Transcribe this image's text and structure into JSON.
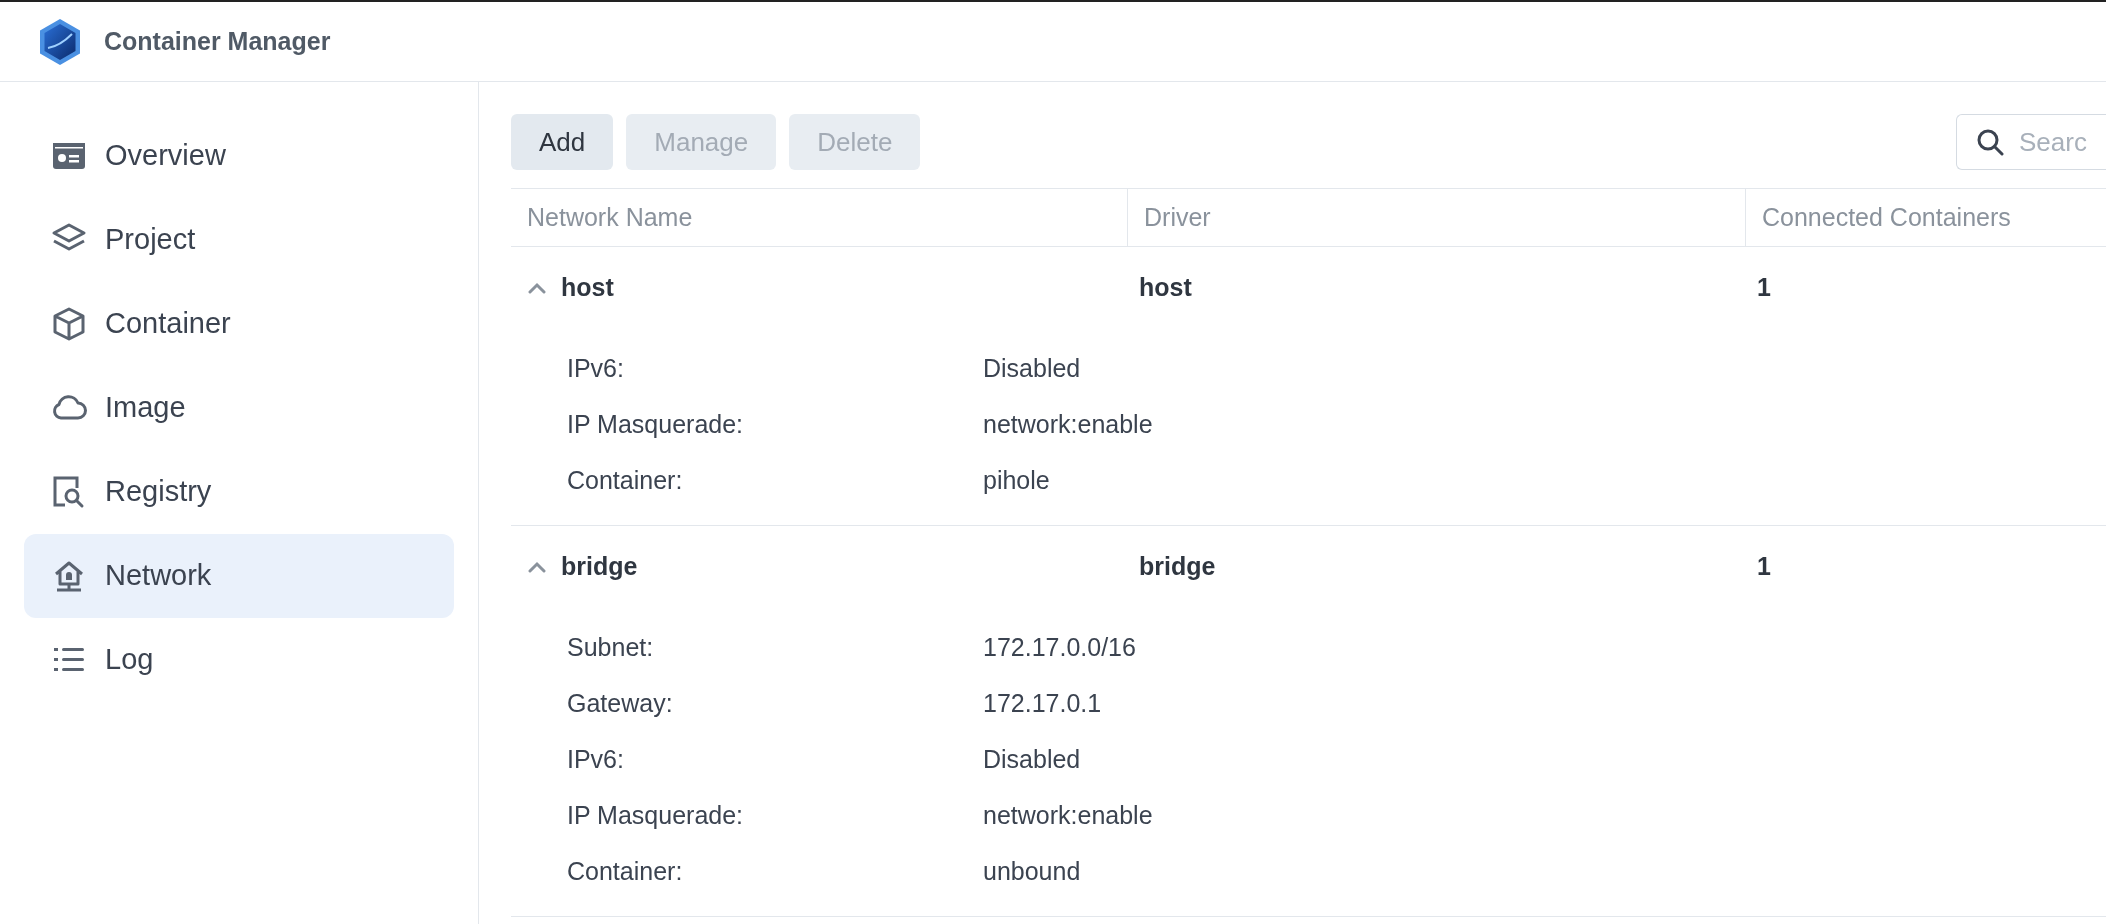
{
  "app": {
    "title": "Container Manager"
  },
  "sidebar": {
    "items": [
      {
        "label": "Overview",
        "kind": "overview",
        "selected": false
      },
      {
        "label": "Project",
        "kind": "project",
        "selected": false
      },
      {
        "label": "Container",
        "kind": "container",
        "selected": false
      },
      {
        "label": "Image",
        "kind": "image",
        "selected": false
      },
      {
        "label": "Registry",
        "kind": "registry",
        "selected": false
      },
      {
        "label": "Network",
        "kind": "network",
        "selected": true
      },
      {
        "label": "Log",
        "kind": "log",
        "selected": false
      }
    ]
  },
  "toolbar": {
    "buttons": [
      {
        "label": "Add",
        "disabled": false
      },
      {
        "label": "Manage",
        "disabled": true
      },
      {
        "label": "Delete",
        "disabled": true
      }
    ],
    "search": {
      "placeholder": "Searc"
    }
  },
  "table": {
    "columns": [
      "Network Name",
      "Driver",
      "Connected Containers"
    ],
    "rows": [
      {
        "name": "host",
        "driver": "host",
        "connected": "1",
        "expanded": true,
        "details": [
          {
            "label": "IPv6:",
            "value": "Disabled"
          },
          {
            "label": "IP Masquerade:",
            "value": "network:enable"
          },
          {
            "label": "Container:",
            "value": "pihole"
          }
        ]
      },
      {
        "name": "bridge",
        "driver": "bridge",
        "connected": "1",
        "expanded": true,
        "details": [
          {
            "label": "Subnet:",
            "value": "172.17.0.0/16"
          },
          {
            "label": "Gateway:",
            "value": "172.17.0.1"
          },
          {
            "label": "IPv6:",
            "value": "Disabled"
          },
          {
            "label": "IP Masquerade:",
            "value": "network:enable"
          },
          {
            "label": "Container:",
            "value": "unbound"
          }
        ]
      }
    ]
  }
}
